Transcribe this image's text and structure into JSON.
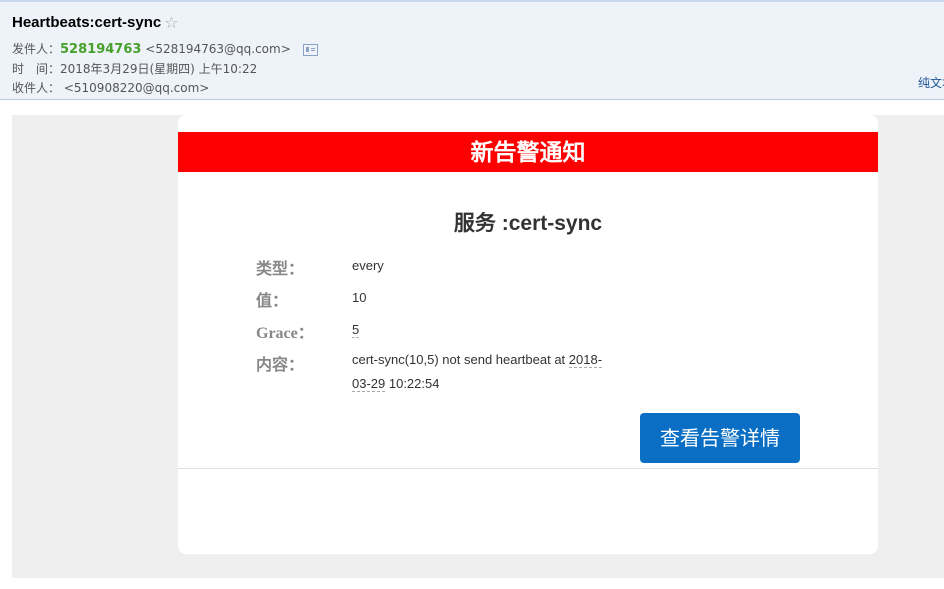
{
  "mail": {
    "subject": "Heartbeats:cert-sync",
    "star_icon": "☆",
    "sender_label": "发件人：",
    "sender_name": "528194763",
    "sender_address": "<528194763@qq.com>",
    "time_label": "时　间：",
    "time_value": "2018年3月29日(星期四) 上午10:22",
    "recipient_label": "收件人：",
    "recipient_address": "<510908220@qq.com>",
    "plain_text_link": "纯文本"
  },
  "alert": {
    "banner_title": "新告警通知",
    "service_title": "服务 :cert-sync",
    "type_label": "类型：",
    "type_value": "every",
    "value_label": "值：",
    "value_value": "10",
    "grace_label": "Grace：",
    "grace_value": "5",
    "content_label": "内容：",
    "content_prefix": "cert-sync(10,5) not send heartbeat at ",
    "content_date_part1": "2018-",
    "content_date_part2": "03-29",
    "content_time": " 10:22:54",
    "detail_button_label": "查看告警详情"
  },
  "colors": {
    "banner": "#ff0000",
    "button": "#0a6fc4",
    "sender_name": "#47a12a",
    "header_bg": "#eef3fa"
  }
}
